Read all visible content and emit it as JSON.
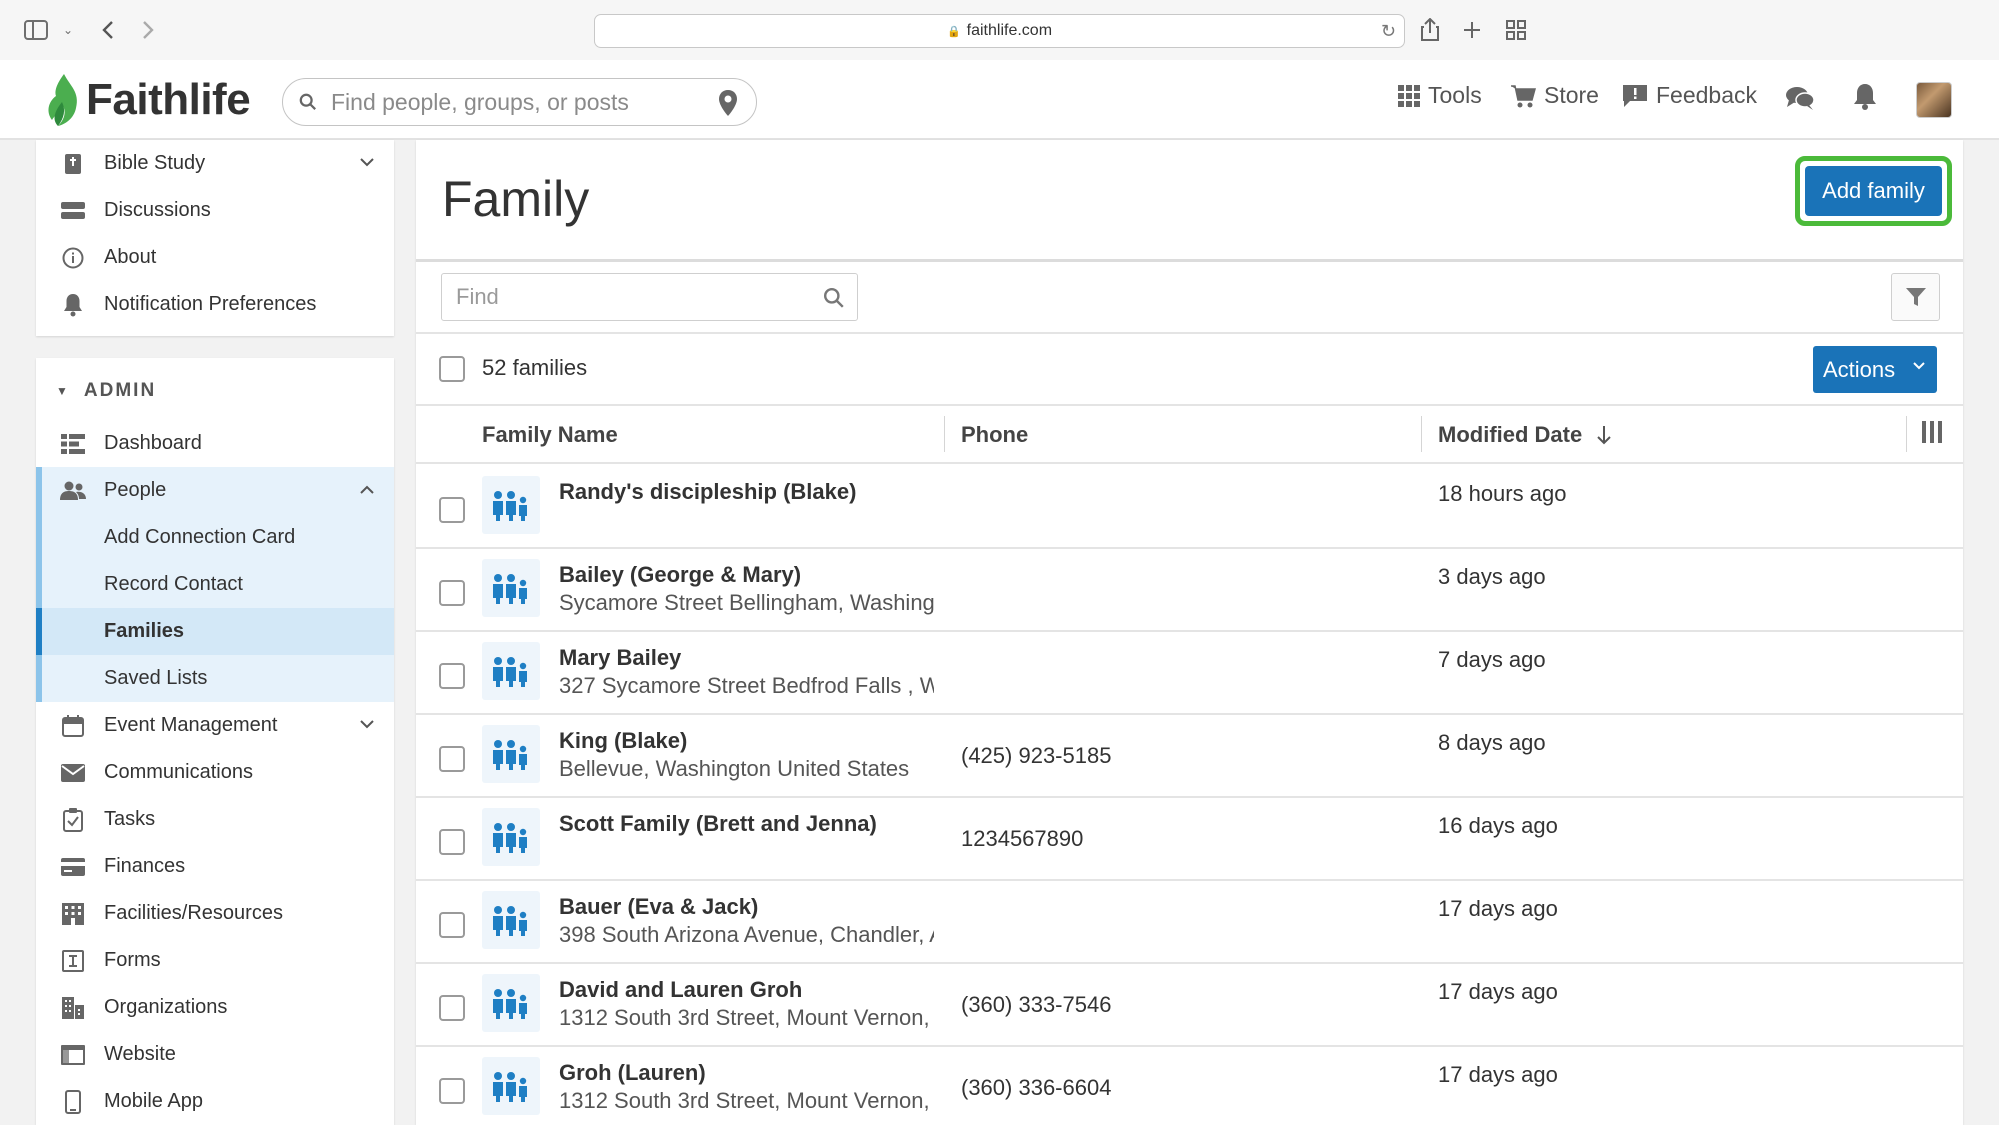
{
  "browser": {
    "url": "faithlife.com"
  },
  "header": {
    "logo_text": "Faithlife",
    "search_placeholder": "Find people, groups, or posts",
    "nav": [
      {
        "label": "Tools",
        "icon": "grid-icon"
      },
      {
        "label": "Store",
        "icon": "cart-icon"
      },
      {
        "label": "Feedback",
        "icon": "feedback-icon"
      }
    ]
  },
  "sidebar": {
    "top_items": [
      {
        "label": "Bible Study",
        "icon": "bible-icon",
        "expandable": true
      },
      {
        "label": "Discussions",
        "icon": "discussions-icon"
      },
      {
        "label": "About",
        "icon": "info-icon"
      },
      {
        "label": "Notification Preferences",
        "icon": "bell-icon"
      }
    ],
    "admin_heading": "ADMIN",
    "admin_items": [
      {
        "label": "Dashboard",
        "icon": "dashboard-icon"
      },
      {
        "label": "People",
        "icon": "people-icon",
        "expanded": true
      },
      {
        "label": "Add Connection Card",
        "sub": true
      },
      {
        "label": "Record Contact",
        "sub": true
      },
      {
        "label": "Families",
        "sub": true,
        "active": true
      },
      {
        "label": "Saved Lists",
        "sub": true
      },
      {
        "label": "Event Management",
        "icon": "calendar-icon",
        "expandable": true
      },
      {
        "label": "Communications",
        "icon": "envelope-icon"
      },
      {
        "label": "Tasks",
        "icon": "clipboard-icon"
      },
      {
        "label": "Finances",
        "icon": "card-icon"
      },
      {
        "label": "Facilities/Resources",
        "icon": "building-icon"
      },
      {
        "label": "Forms",
        "icon": "form-icon"
      },
      {
        "label": "Organizations",
        "icon": "org-icon"
      },
      {
        "label": "Website",
        "icon": "website-icon"
      },
      {
        "label": "Mobile App",
        "icon": "phone-icon"
      }
    ]
  },
  "main": {
    "title": "Family",
    "add_button": "Add family",
    "find_placeholder": "Find",
    "count_label": "52 families",
    "actions_label": "Actions",
    "columns": {
      "name": "Family Name",
      "phone": "Phone",
      "modified": "Modified Date"
    },
    "rows": [
      {
        "name": "Randy's discipleship (Blake)",
        "address": "",
        "phone": "",
        "modified": "18 hours ago"
      },
      {
        "name": "Bailey (George & Mary)",
        "address": "Sycamore Street Bellingham, Washing",
        "phone": "",
        "modified": "3 days ago"
      },
      {
        "name": "Mary Bailey",
        "address": "327 Sycamore Street Bedfrod Falls , W/",
        "phone": "",
        "modified": "7 days ago"
      },
      {
        "name": "King (Blake)",
        "address": "Bellevue, Washington United States",
        "phone": "(425) 923-5185",
        "modified": "8 days ago"
      },
      {
        "name": "Scott Family (Brett and Jenna)",
        "address": "",
        "phone": "1234567890",
        "modified": "16 days ago"
      },
      {
        "name": "Bauer (Eva & Jack)",
        "address": "398 South Arizona Avenue, Chandler, A",
        "phone": "",
        "modified": "17 days ago"
      },
      {
        "name": "David and Lauren Groh",
        "address": "1312 South 3rd Street, Mount Vernon, '",
        "phone": "(360) 333-7546",
        "modified": "17 days ago"
      },
      {
        "name": "Groh (Lauren)",
        "address": "1312 South 3rd Street, Mount Vernon, '",
        "phone": "(360) 336-6604",
        "modified": "17 days ago"
      }
    ]
  },
  "colors": {
    "primary": "#1a73b8",
    "highlight_ring": "#4bba3a",
    "logo_green": "#4bae4f",
    "family_icon": "#1f7fc4"
  }
}
